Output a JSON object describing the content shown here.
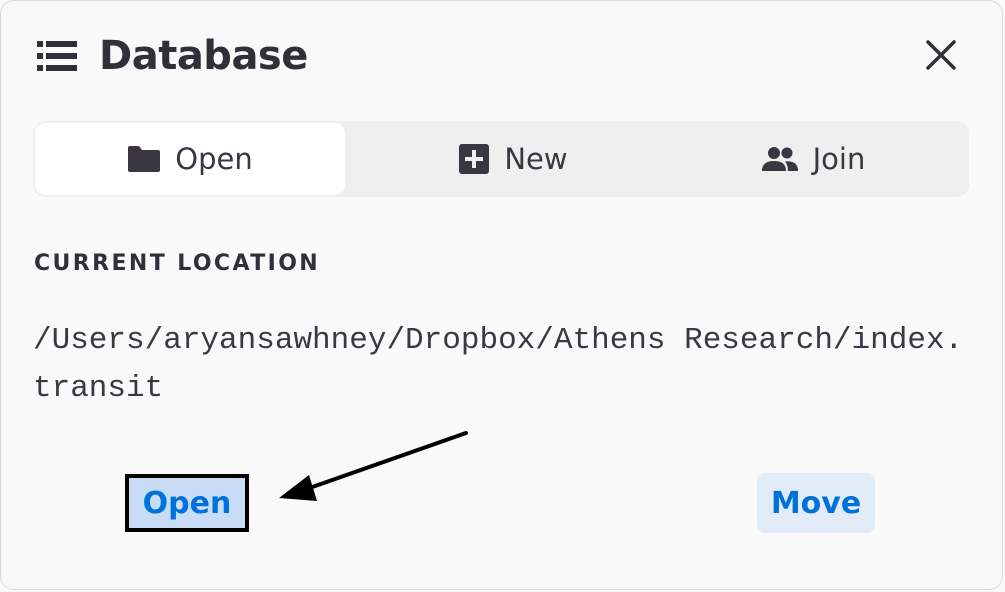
{
  "header": {
    "title": "Database",
    "icon": "database-list-icon"
  },
  "tabs": [
    {
      "label": "Open",
      "icon": "folder-icon",
      "active": true
    },
    {
      "label": "New",
      "icon": "plus-box-icon",
      "active": false
    },
    {
      "label": "Join",
      "icon": "people-icon",
      "active": false
    }
  ],
  "location": {
    "label": "CURRENT LOCATION",
    "path": "/Users/aryansawhney/Dropbox/Athens Research/index.transit"
  },
  "actions": {
    "open_label": "Open",
    "move_label": "Move"
  },
  "colors": {
    "accent": "#0071db",
    "open_button_bg": "#c9dcf5",
    "move_button_bg": "#e2ecf8",
    "text": "#322f38"
  }
}
